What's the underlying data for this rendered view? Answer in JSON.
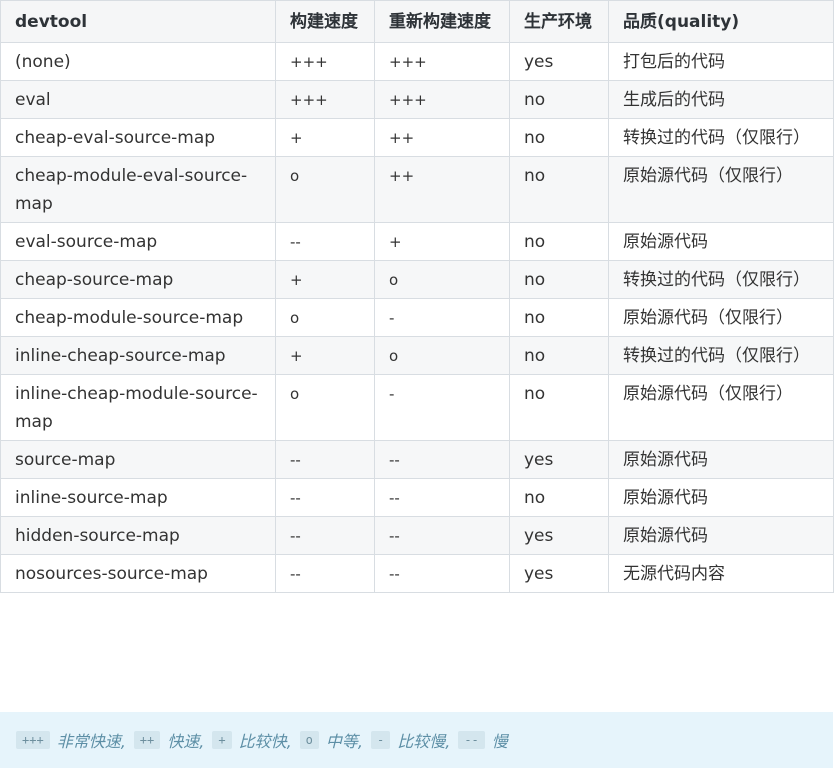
{
  "table": {
    "headers": [
      "devtool",
      "构建速度",
      "重新构建速度",
      "生产环境",
      "品质(quality)"
    ],
    "rows": [
      [
        "(none)",
        "+++",
        "+++",
        "yes",
        "打包后的代码"
      ],
      [
        "eval",
        "+++",
        "+++",
        "no",
        "生成后的代码"
      ],
      [
        "cheap-eval-source-map",
        "+",
        "++",
        "no",
        "转换过的代码（仅限行）"
      ],
      [
        "cheap-module-eval-source-map",
        "o",
        "++",
        "no",
        "原始源代码（仅限行）"
      ],
      [
        "eval-source-map",
        "--",
        "+",
        "no",
        "原始源代码"
      ],
      [
        "cheap-source-map",
        "+",
        "o",
        "no",
        "转换过的代码（仅限行）"
      ],
      [
        "cheap-module-source-map",
        "o",
        "-",
        "no",
        "原始源代码（仅限行）"
      ],
      [
        "inline-cheap-source-map",
        "+",
        "o",
        "no",
        "转换过的代码（仅限行）"
      ],
      [
        "inline-cheap-module-source-map",
        "o",
        "-",
        "no",
        "原始源代码（仅限行）"
      ],
      [
        "source-map",
        "--",
        "--",
        "yes",
        "原始源代码"
      ],
      [
        "inline-source-map",
        "--",
        "--",
        "no",
        "原始源代码"
      ],
      [
        "hidden-source-map",
        "--",
        "--",
        "yes",
        "原始源代码"
      ],
      [
        "nosources-source-map",
        "--",
        "--",
        "yes",
        "无源代码内容"
      ]
    ]
  },
  "legend": [
    {
      "symbol": "+++",
      "text": "非常快速,"
    },
    {
      "symbol": "++",
      "text": "快速,"
    },
    {
      "symbol": "+",
      "text": "比较快,"
    },
    {
      "symbol": "o",
      "text": "中等,"
    },
    {
      "symbol": "-",
      "text": "比较慢,"
    },
    {
      "symbol": "--",
      "text": "慢"
    }
  ]
}
